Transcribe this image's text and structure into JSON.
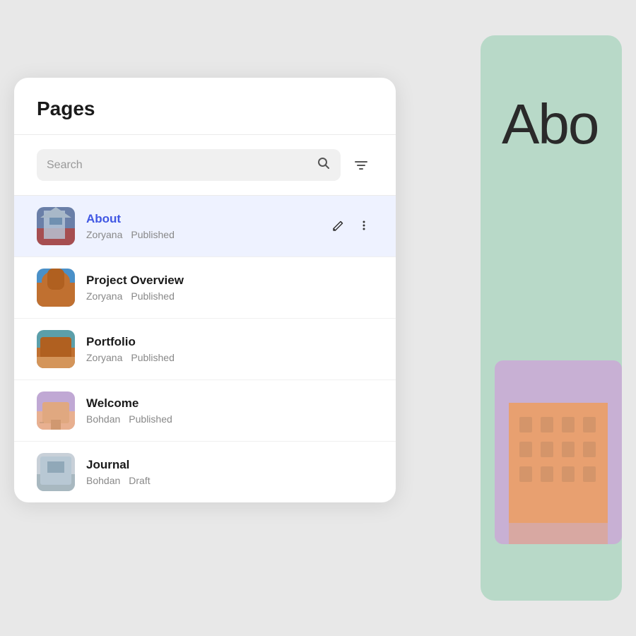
{
  "title": "Pages",
  "search": {
    "placeholder": "Search",
    "filter_label": "Filter"
  },
  "background": {
    "panel_color": "#b8d9c8",
    "text": "Abo"
  },
  "pages": [
    {
      "id": "about",
      "name": "About",
      "author": "Zoryana",
      "status": "Published",
      "active": true,
      "thumb_type": "blue_building"
    },
    {
      "id": "project-overview",
      "name": "Project Overview",
      "author": "Zoryana",
      "status": "Published",
      "active": false,
      "thumb_type": "orange_arch"
    },
    {
      "id": "portfolio",
      "name": "Portfolio",
      "author": "Zoryana",
      "status": "Published",
      "active": false,
      "thumb_type": "teal_wall"
    },
    {
      "id": "welcome",
      "name": "Welcome",
      "author": "Bohdan",
      "status": "Published",
      "active": false,
      "thumb_type": "purple_building"
    },
    {
      "id": "journal",
      "name": "Journal",
      "author": "Bohdan",
      "status": "Draft",
      "active": false,
      "thumb_type": "grey_sky"
    }
  ],
  "icons": {
    "search": "🔍",
    "filter": "⊟",
    "edit": "✏",
    "more": "⋮"
  }
}
